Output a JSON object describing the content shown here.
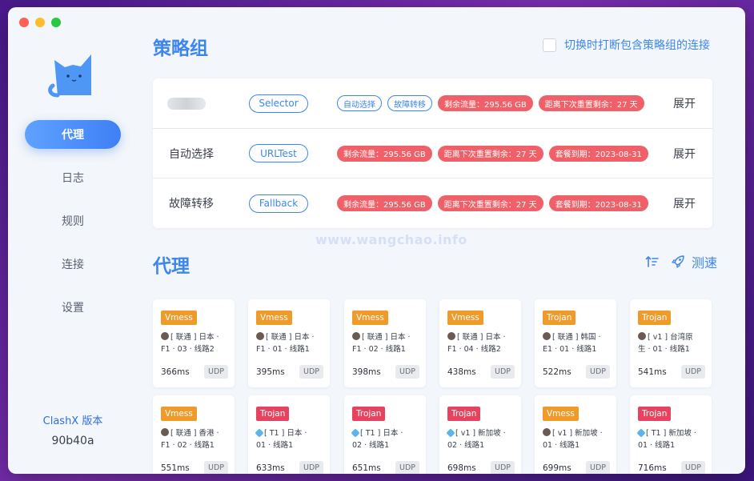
{
  "sidebar": {
    "nav": [
      {
        "label": "代理",
        "active": true
      },
      {
        "label": "日志",
        "active": false
      },
      {
        "label": "规则",
        "active": false
      },
      {
        "label": "连接",
        "active": false
      },
      {
        "label": "设置",
        "active": false
      }
    ],
    "version_label": "ClashX 版本",
    "version_value": "90b40a"
  },
  "groups_section": {
    "title": "策略组",
    "toggle_label": "切换时打断包含策略组的连接",
    "groups": [
      {
        "name": "",
        "type": "Selector",
        "tags_outline": [
          "自动选择",
          "故障转移"
        ],
        "tags_info": [
          "剩余流量：295.56 GB",
          "距离下次重置剩余：27 天"
        ],
        "expand": "展开"
      },
      {
        "name": "自动选择",
        "type": "URLTest",
        "tags_outline": [],
        "tags_info": [
          "剩余流量：295.56 GB",
          "距离下次重置剩余：27 天",
          "套餐到期：2023-08-31"
        ],
        "expand": "展开"
      },
      {
        "name": "故障转移",
        "type": "Fallback",
        "tags_outline": [],
        "tags_info": [
          "剩余流量：295.56 GB",
          "距离下次重置剩余：27 天",
          "套餐到期：2023-08-31"
        ],
        "expand": "展开"
      }
    ]
  },
  "watermark": "www.wangchao.info",
  "proxies_section": {
    "title": "代理",
    "speed_test_label": "测速",
    "proxies": [
      {
        "type": "Vmess",
        "name_l1": "[ 联通 ] 日本 ·",
        "name_l2": "F1 · 03 · 线路2",
        "latency": "366ms",
        "udp": "UDP",
        "emoji": "robot"
      },
      {
        "type": "Vmess",
        "name_l1": "[ 联通 ] 日本 ·",
        "name_l2": "F1 · 01 · 线路1",
        "latency": "395ms",
        "udp": "UDP",
        "emoji": "robot"
      },
      {
        "type": "Vmess",
        "name_l1": "[ 联通 ] 日本 ·",
        "name_l2": "F1 · 02 · 线路1",
        "latency": "398ms",
        "udp": "UDP",
        "emoji": "robot"
      },
      {
        "type": "Vmess",
        "name_l1": "[ 联通 ] 日本 ·",
        "name_l2": "F1 · 04 · 线路2",
        "latency": "438ms",
        "udp": "UDP",
        "emoji": "robot"
      },
      {
        "type": "Trojan",
        "name_l1": "[ 联通 ] 韩国 ·",
        "name_l2": "E1 · 01 · 线路1",
        "latency": "522ms",
        "udp": "UDP",
        "emoji": "robot"
      },
      {
        "type": "Trojan",
        "name_l1": "[ v1 ] 台湾原",
        "name_l2": "生 · 01 · 线路1",
        "latency": "541ms",
        "udp": "UDP",
        "emoji": "robot"
      },
      {
        "type": "Vmess",
        "name_l1": "[ 联通 ] 香港 ·",
        "name_l2": "F1 · 02 · 线路1",
        "latency": "551ms",
        "udp": "UDP",
        "emoji": "robot"
      },
      {
        "type": "Trojan",
        "name_l1": "[ T1 ] 日本 ·",
        "name_l2": "01 · 线路1",
        "latency": "633ms",
        "udp": "UDP",
        "emoji": "gem"
      },
      {
        "type": "Trojan",
        "name_l1": "[ T1 ] 日本 ·",
        "name_l2": "02 · 线路1",
        "latency": "651ms",
        "udp": "UDP",
        "emoji": "gem"
      },
      {
        "type": "Trojan",
        "name_l1": "[ v1 ] 新加坡 ·",
        "name_l2": "02 · 线路1",
        "latency": "698ms",
        "udp": "UDP",
        "emoji": "gem"
      },
      {
        "type": "Vmess",
        "name_l1": "[ v1 ] 新加坡 ·",
        "name_l2": "01 · 线路1",
        "latency": "699ms",
        "udp": "UDP",
        "emoji": "robot"
      },
      {
        "type": "Trojan",
        "name_l1": "[ T1 ] 新加坡 ·",
        "name_l2": "01 · 线路1",
        "latency": "716ms",
        "udp": "UDP",
        "emoji": "gem"
      }
    ]
  },
  "colors": {
    "accent": "#3d86f2",
    "danger": "#ef6068",
    "vmess": "#f09a2a",
    "trojan": "#e8435e"
  }
}
